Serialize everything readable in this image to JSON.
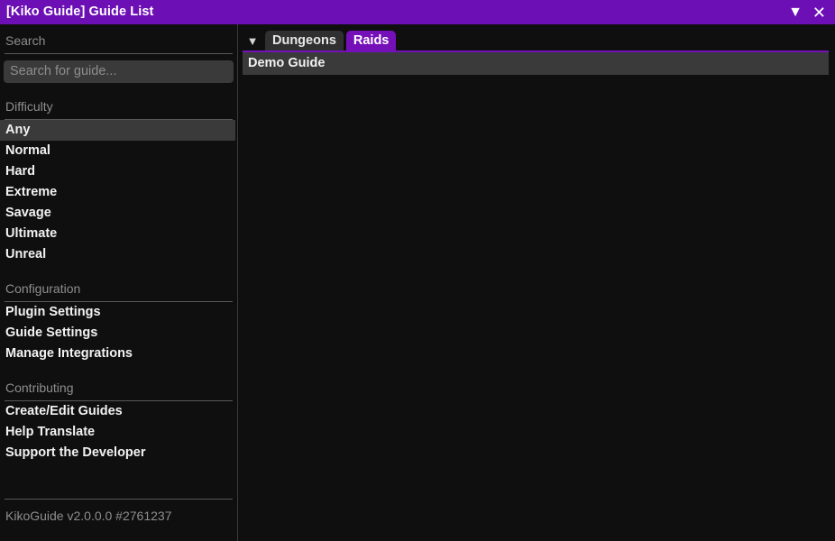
{
  "window": {
    "title": "[Kiko Guide] Guide List",
    "collapse_icon": "▼",
    "close_icon": "✕",
    "accent_color": "#7510b8",
    "titlebar_color": "#6c0fb5"
  },
  "sidebar": {
    "search": {
      "header": "Search",
      "placeholder": "Search for guide...",
      "value": ""
    },
    "groups": [
      {
        "header": "Difficulty",
        "items": [
          {
            "label": "Any",
            "selected": true
          },
          {
            "label": "Normal",
            "selected": false
          },
          {
            "label": "Hard",
            "selected": false
          },
          {
            "label": "Extreme",
            "selected": false
          },
          {
            "label": "Savage",
            "selected": false
          },
          {
            "label": "Ultimate",
            "selected": false
          },
          {
            "label": "Unreal",
            "selected": false
          }
        ]
      },
      {
        "header": "Configuration",
        "items": [
          {
            "label": "Plugin Settings",
            "selected": false
          },
          {
            "label": "Guide Settings",
            "selected": false
          },
          {
            "label": "Manage Integrations",
            "selected": false
          }
        ]
      },
      {
        "header": "Contributing",
        "items": [
          {
            "label": "Create/Edit Guides",
            "selected": false
          },
          {
            "label": "Help Translate",
            "selected": false
          },
          {
            "label": "Support the Developer",
            "selected": false
          }
        ]
      }
    ],
    "footer": {
      "version_text": "KikoGuide v2.0.0.0 #2761237"
    }
  },
  "content": {
    "tab_arrow_icon": "▼",
    "tabs": [
      {
        "label": "Dungeons",
        "active": false
      },
      {
        "label": "Raids",
        "active": true
      }
    ],
    "guides": [
      {
        "label": "Demo Guide"
      }
    ]
  }
}
